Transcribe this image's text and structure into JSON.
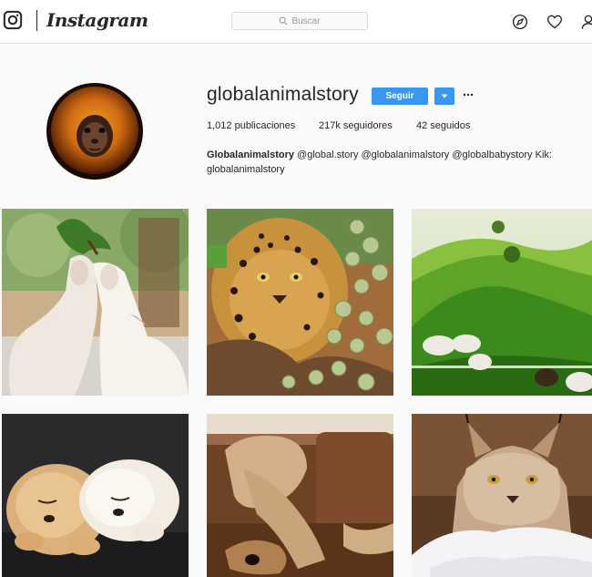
{
  "nav": {
    "brand": "Instagram",
    "search_placeholder": "Buscar",
    "icons": [
      "instagram-logo-icon",
      "compass-icon",
      "heart-icon",
      "user-icon"
    ]
  },
  "profile": {
    "username": "globalanimalstory",
    "follow_label": "Seguir",
    "stats": {
      "posts": "1,012 publicaciones",
      "followers": "217k seguidores",
      "following": "42 seguidos"
    },
    "bio_name": "Globalanimalstory",
    "bio_text": " @global.story @globalanimalstory @globalbabystory Kik:",
    "bio_line2": "globalanimalstory"
  },
  "posts": [
    {
      "subject": "goats-eating-leaves"
    },
    {
      "subject": "leopard-with-berries"
    },
    {
      "subject": "sheep-on-green-hills"
    },
    {
      "subject": "sleeping-puppies"
    },
    {
      "subject": "dog-on-sofa"
    },
    {
      "subject": "lynx-in-snow"
    }
  ],
  "colors": {
    "accent": "#3897f0",
    "text": "#262626",
    "border": "#dbdbdb",
    "background": "#fafafa"
  }
}
